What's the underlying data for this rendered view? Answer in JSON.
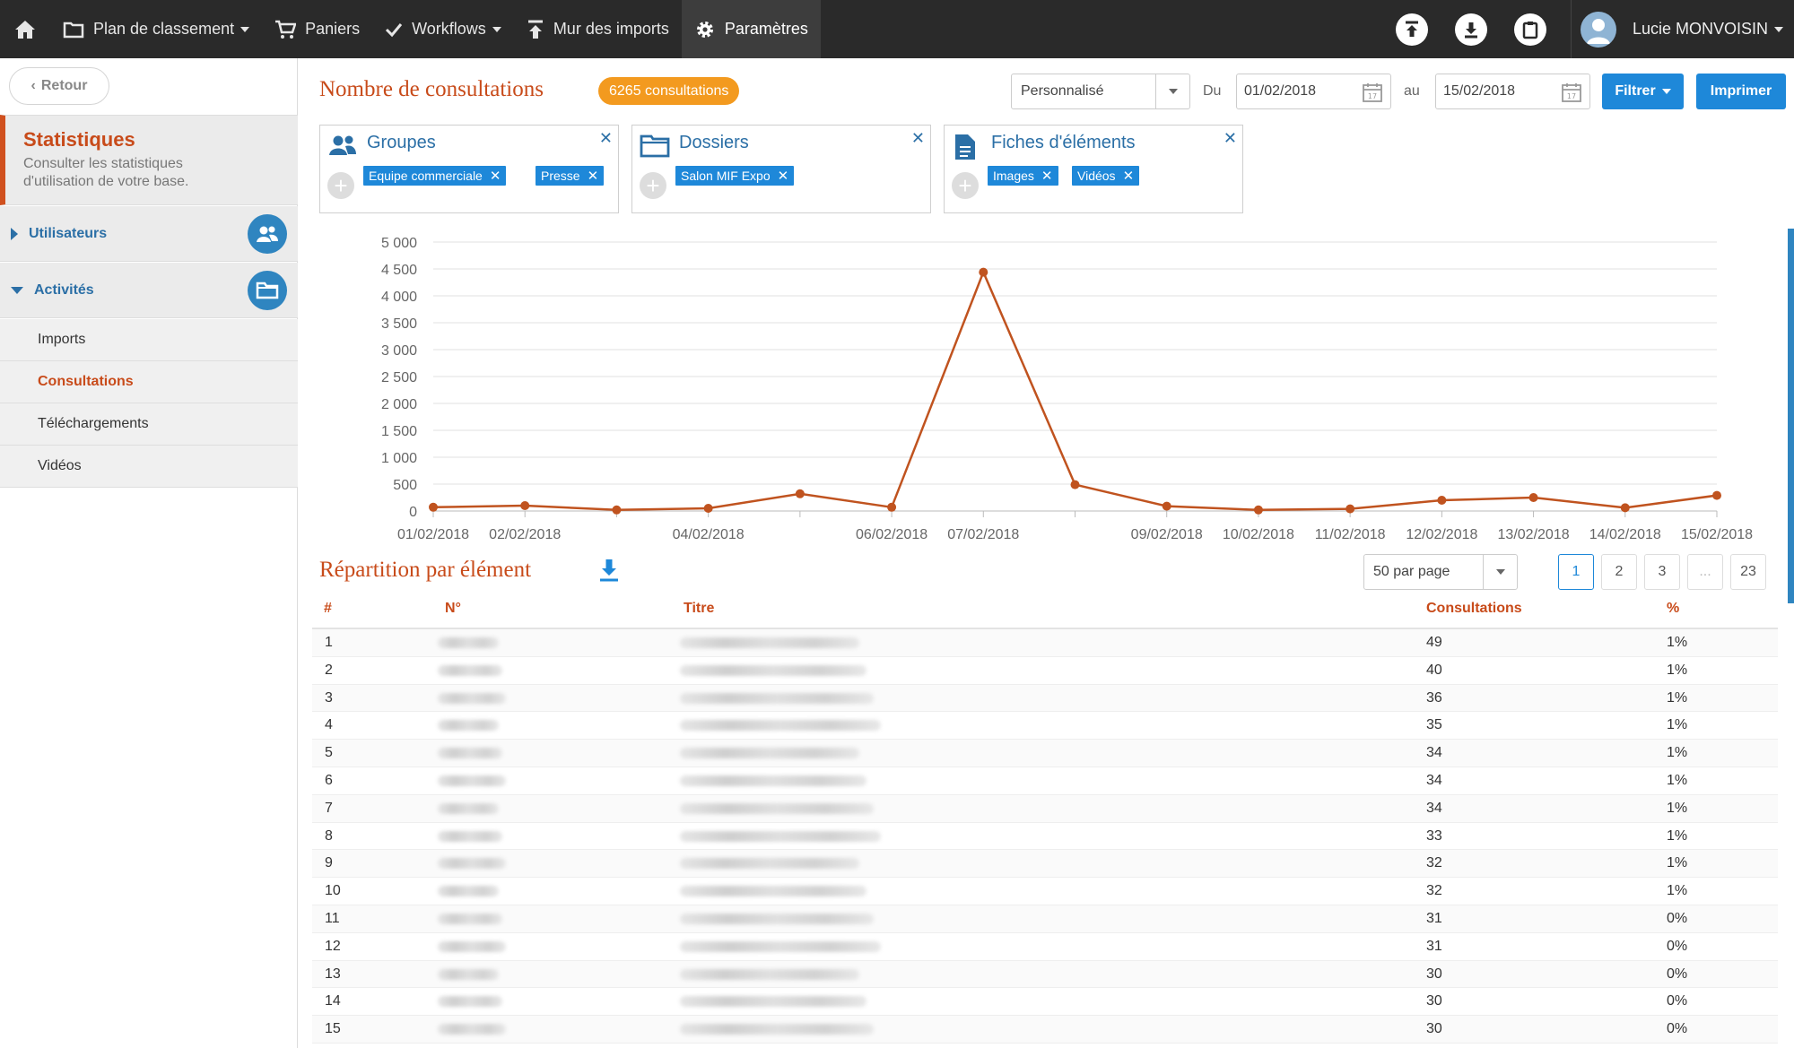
{
  "topbar": {
    "nav": [
      {
        "label": "Plan de classement",
        "icon": "folder-icon",
        "dropdown": true
      },
      {
        "label": "Paniers",
        "icon": "cart-icon",
        "dropdown": false
      },
      {
        "label": "Workflows",
        "icon": "check-icon",
        "dropdown": true
      },
      {
        "label": "Mur des imports",
        "icon": "upload-icon",
        "dropdown": false
      },
      {
        "label": "Paramètres",
        "icon": "gear-icon",
        "dropdown": false,
        "active": true
      }
    ],
    "user_name": "Lucie MONVOISIN"
  },
  "sidebar": {
    "back_label": "Retour",
    "title": "Statistiques",
    "subtitle": "Consulter les statistiques d'utilisation de votre base.",
    "sections": [
      {
        "label": "Utilisateurs",
        "icon": "users-icon",
        "expanded": false
      },
      {
        "label": "Activités",
        "icon": "folder-icon",
        "expanded": true
      }
    ],
    "items": [
      {
        "label": "Imports"
      },
      {
        "label": "Consultations",
        "active": true
      },
      {
        "label": "Téléchargements"
      },
      {
        "label": "Vidéos"
      }
    ]
  },
  "header": {
    "title": "Nombre de consultations",
    "count_badge": "6265 consultations",
    "period": "Personnalisé",
    "from_label": "Du",
    "from_date": "01/02/2018",
    "to_label": "au",
    "to_date": "15/02/2018",
    "filter_label": "Filtrer",
    "print_label": "Imprimer"
  },
  "filters": [
    {
      "title": "Groupes",
      "icon": "users-icon",
      "tags": [
        "Equipe commerciale",
        "Presse"
      ]
    },
    {
      "title": "Dossiers",
      "icon": "folder-icon",
      "tags": [
        "Salon MIF Expo"
      ]
    },
    {
      "title": "Fiches d'éléments",
      "icon": "document-icon",
      "tags": [
        "Images",
        "Vidéos"
      ]
    }
  ],
  "chart_data": {
    "type": "line",
    "ylim": [
      0,
      5000
    ],
    "yticks": [
      "0",
      "500",
      "1 000",
      "1 500",
      "2 000",
      "2 500",
      "3 000",
      "3 500",
      "4 000",
      "4 500",
      "5 000"
    ],
    "x": [
      "01/02/2018",
      "02/02/2018",
      "03/02/2018",
      "04/02/2018",
      "05/02/2018",
      "06/02/2018",
      "07/02/2018",
      "08/02/2018",
      "09/02/2018",
      "10/02/2018",
      "11/02/2018",
      "12/02/2018",
      "13/02/2018",
      "14/02/2018",
      "15/02/2018"
    ],
    "xticklabels": [
      "01/02/2018",
      "02/02/2018",
      "",
      "04/02/2018",
      "",
      "06/02/2018",
      "07/02/2018",
      "",
      "09/02/2018",
      "10/02/2018",
      "11/02/2018",
      "12/02/2018",
      "13/02/2018",
      "14/02/2018",
      "15/02/2018"
    ],
    "values": [
      70,
      100,
      20,
      50,
      320,
      70,
      4440,
      490,
      90,
      20,
      40,
      200,
      250,
      60,
      290
    ],
    "color": "#c0531f",
    "grid": true
  },
  "repartition": {
    "title": "Répartition par élément",
    "per_page": "50 par page",
    "pages": [
      "1",
      "2",
      "3",
      "...",
      "23"
    ],
    "columns": [
      "#",
      "N°",
      "Titre",
      "Consultations",
      "%"
    ],
    "rows": [
      {
        "rank": "1",
        "consultations": "49",
        "pct": "1%"
      },
      {
        "rank": "2",
        "consultations": "40",
        "pct": "1%"
      },
      {
        "rank": "3",
        "consultations": "36",
        "pct": "1%"
      },
      {
        "rank": "4",
        "consultations": "35",
        "pct": "1%"
      },
      {
        "rank": "5",
        "consultations": "34",
        "pct": "1%"
      },
      {
        "rank": "6",
        "consultations": "34",
        "pct": "1%"
      },
      {
        "rank": "7",
        "consultations": "34",
        "pct": "1%"
      },
      {
        "rank": "8",
        "consultations": "33",
        "pct": "1%"
      },
      {
        "rank": "9",
        "consultations": "32",
        "pct": "1%"
      },
      {
        "rank": "10",
        "consultations": "32",
        "pct": "1%"
      },
      {
        "rank": "11",
        "consultations": "31",
        "pct": "0%"
      },
      {
        "rank": "12",
        "consultations": "31",
        "pct": "0%"
      },
      {
        "rank": "13",
        "consultations": "30",
        "pct": "0%"
      },
      {
        "rank": "14",
        "consultations": "30",
        "pct": "0%"
      },
      {
        "rank": "15",
        "consultations": "30",
        "pct": "0%"
      }
    ]
  }
}
